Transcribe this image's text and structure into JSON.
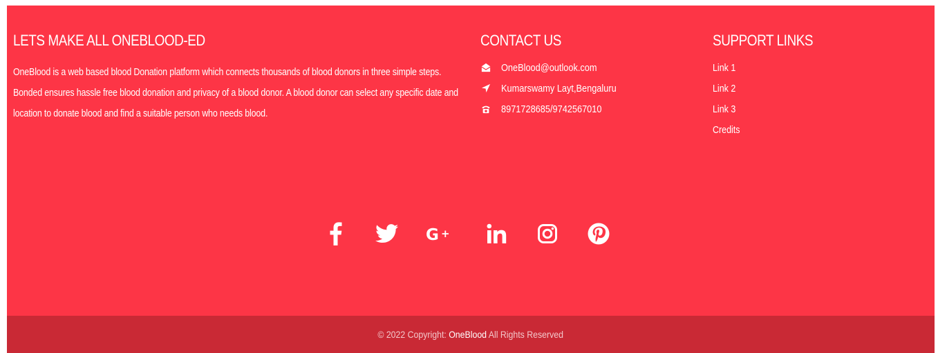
{
  "about": {
    "heading": "LETS MAKE ALL ONEBLOOD-ED",
    "text": "OneBlood is a web based blood Donation platform which connects thousands of blood donors in three simple steps. Bonded ensures hassle free blood donation and privacy of a blood donor. A blood donor can select any specific date and location to donate blood and find a suitable person who needs blood."
  },
  "contact": {
    "heading": "CONTACT US",
    "items": [
      {
        "icon": "envelope-icon",
        "text": "OneBlood@outlook.com"
      },
      {
        "icon": "location-arrow-icon",
        "text": "Kumarswamy Layt,Bengaluru"
      },
      {
        "icon": "phone-icon",
        "text": "8971728685/9742567010"
      }
    ]
  },
  "support": {
    "heading": "SUPPORT LINKS",
    "links": [
      "Link 1",
      "Link 2",
      "Link 3",
      "Credits"
    ]
  },
  "social": [
    "facebook-icon",
    "twitter-icon",
    "google-plus-icon",
    "linkedin-icon",
    "instagram-icon",
    "pinterest-icon"
  ],
  "copyright": {
    "prefix": "© 2022 Copyright: ",
    "brand": "OneBlood",
    "suffix": " All Rights Reserved"
  },
  "colors": {
    "footer_bg": "#fd3546",
    "bottom_bar_bg": "#c92935",
    "text": "#ffffff"
  }
}
